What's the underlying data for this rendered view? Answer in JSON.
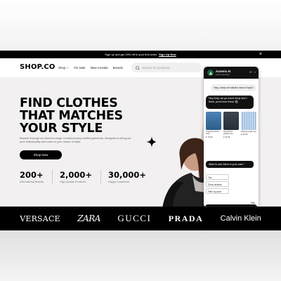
{
  "announcement": {
    "text": "Sign up and get 20% off to your first order.",
    "link": "Sign Up Now",
    "close_glyph": "×"
  },
  "nav": {
    "logo": "SHOP.CO",
    "links": [
      "Shop",
      "On Sale",
      "New Arrivals",
      "Brands"
    ],
    "shop_chevron": "⌄",
    "search_placeholder": "Search for products..."
  },
  "hero": {
    "title_lines": [
      "FIND CLOTHES",
      "THAT MATCHES",
      "YOUR STYLE"
    ],
    "description": "Browse through our diverse range of meticulously crafted garments, designed to bring out your individuality and cater to your sense of style.",
    "cta": "Shop Now",
    "stats": [
      {
        "number": "200+",
        "label": "International Brands"
      },
      {
        "number": "2,000+",
        "label": "High-Quality Products"
      },
      {
        "number": "30,000+",
        "label": "Happy Customers"
      }
    ]
  },
  "brands": [
    "VERSACE",
    "ZARA",
    "GUCCI",
    "PRADA",
    "Calvin Klein"
  ],
  "chat": {
    "name": "Aurenis AI",
    "status": "Likes Assistant",
    "controls": [
      "⟳",
      "×"
    ],
    "user_message": "Hey, show me what's new in tops?",
    "bot_message": "Hey Amy, we go some shop and I think, you'd love these 🛍",
    "products": [
      {
        "name": "Cropped denim shirt",
        "price": "£ 79.99",
        "color": "#3b6f9e"
      },
      {
        "name": "Oversized graphic tee",
        "price": "£ 21.99",
        "color": "#2f3b47"
      },
      {
        "name": "Striped poplin top",
        "price": "£ 46.99",
        "color": "#b9cfe6"
      }
    ],
    "bot_question": "Want to see them in your size?",
    "options": [
      "Yes",
      "Show similars",
      "Filter by price"
    ],
    "reply": "Yes"
  },
  "colors": {
    "accent": "#000000",
    "background": "#f2f0f1",
    "chat_avatar": "#1d5e3a"
  }
}
